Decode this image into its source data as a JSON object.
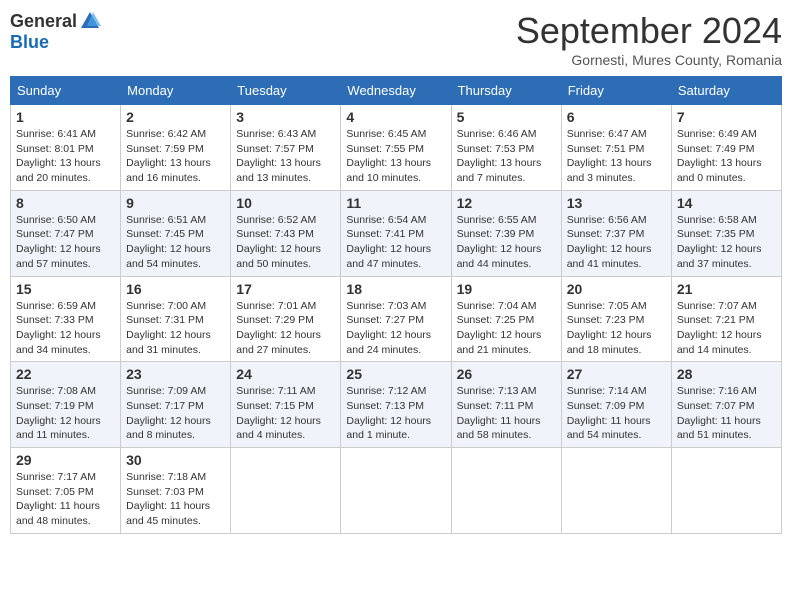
{
  "header": {
    "logo_general": "General",
    "logo_blue": "Blue",
    "month": "September 2024",
    "location": "Gornesti, Mures County, Romania"
  },
  "days_of_week": [
    "Sunday",
    "Monday",
    "Tuesday",
    "Wednesday",
    "Thursday",
    "Friday",
    "Saturday"
  ],
  "weeks": [
    [
      {
        "day": "1",
        "sunrise": "6:41 AM",
        "sunset": "8:01 PM",
        "daylight": "13 hours and 20 minutes."
      },
      {
        "day": "2",
        "sunrise": "6:42 AM",
        "sunset": "7:59 PM",
        "daylight": "13 hours and 16 minutes."
      },
      {
        "day": "3",
        "sunrise": "6:43 AM",
        "sunset": "7:57 PM",
        "daylight": "13 hours and 13 minutes."
      },
      {
        "day": "4",
        "sunrise": "6:45 AM",
        "sunset": "7:55 PM",
        "daylight": "13 hours and 10 minutes."
      },
      {
        "day": "5",
        "sunrise": "6:46 AM",
        "sunset": "7:53 PM",
        "daylight": "13 hours and 7 minutes."
      },
      {
        "day": "6",
        "sunrise": "6:47 AM",
        "sunset": "7:51 PM",
        "daylight": "13 hours and 3 minutes."
      },
      {
        "day": "7",
        "sunrise": "6:49 AM",
        "sunset": "7:49 PM",
        "daylight": "13 hours and 0 minutes."
      }
    ],
    [
      {
        "day": "8",
        "sunrise": "6:50 AM",
        "sunset": "7:47 PM",
        "daylight": "12 hours and 57 minutes."
      },
      {
        "day": "9",
        "sunrise": "6:51 AM",
        "sunset": "7:45 PM",
        "daylight": "12 hours and 54 minutes."
      },
      {
        "day": "10",
        "sunrise": "6:52 AM",
        "sunset": "7:43 PM",
        "daylight": "12 hours and 50 minutes."
      },
      {
        "day": "11",
        "sunrise": "6:54 AM",
        "sunset": "7:41 PM",
        "daylight": "12 hours and 47 minutes."
      },
      {
        "day": "12",
        "sunrise": "6:55 AM",
        "sunset": "7:39 PM",
        "daylight": "12 hours and 44 minutes."
      },
      {
        "day": "13",
        "sunrise": "6:56 AM",
        "sunset": "7:37 PM",
        "daylight": "12 hours and 41 minutes."
      },
      {
        "day": "14",
        "sunrise": "6:58 AM",
        "sunset": "7:35 PM",
        "daylight": "12 hours and 37 minutes."
      }
    ],
    [
      {
        "day": "15",
        "sunrise": "6:59 AM",
        "sunset": "7:33 PM",
        "daylight": "12 hours and 34 minutes."
      },
      {
        "day": "16",
        "sunrise": "7:00 AM",
        "sunset": "7:31 PM",
        "daylight": "12 hours and 31 minutes."
      },
      {
        "day": "17",
        "sunrise": "7:01 AM",
        "sunset": "7:29 PM",
        "daylight": "12 hours and 27 minutes."
      },
      {
        "day": "18",
        "sunrise": "7:03 AM",
        "sunset": "7:27 PM",
        "daylight": "12 hours and 24 minutes."
      },
      {
        "day": "19",
        "sunrise": "7:04 AM",
        "sunset": "7:25 PM",
        "daylight": "12 hours and 21 minutes."
      },
      {
        "day": "20",
        "sunrise": "7:05 AM",
        "sunset": "7:23 PM",
        "daylight": "12 hours and 18 minutes."
      },
      {
        "day": "21",
        "sunrise": "7:07 AM",
        "sunset": "7:21 PM",
        "daylight": "12 hours and 14 minutes."
      }
    ],
    [
      {
        "day": "22",
        "sunrise": "7:08 AM",
        "sunset": "7:19 PM",
        "daylight": "12 hours and 11 minutes."
      },
      {
        "day": "23",
        "sunrise": "7:09 AM",
        "sunset": "7:17 PM",
        "daylight": "12 hours and 8 minutes."
      },
      {
        "day": "24",
        "sunrise": "7:11 AM",
        "sunset": "7:15 PM",
        "daylight": "12 hours and 4 minutes."
      },
      {
        "day": "25",
        "sunrise": "7:12 AM",
        "sunset": "7:13 PM",
        "daylight": "12 hours and 1 minute."
      },
      {
        "day": "26",
        "sunrise": "7:13 AM",
        "sunset": "7:11 PM",
        "daylight": "11 hours and 58 minutes."
      },
      {
        "day": "27",
        "sunrise": "7:14 AM",
        "sunset": "7:09 PM",
        "daylight": "11 hours and 54 minutes."
      },
      {
        "day": "28",
        "sunrise": "7:16 AM",
        "sunset": "7:07 PM",
        "daylight": "11 hours and 51 minutes."
      }
    ],
    [
      {
        "day": "29",
        "sunrise": "7:17 AM",
        "sunset": "7:05 PM",
        "daylight": "11 hours and 48 minutes."
      },
      {
        "day": "30",
        "sunrise": "7:18 AM",
        "sunset": "7:03 PM",
        "daylight": "11 hours and 45 minutes."
      },
      null,
      null,
      null,
      null,
      null
    ]
  ]
}
